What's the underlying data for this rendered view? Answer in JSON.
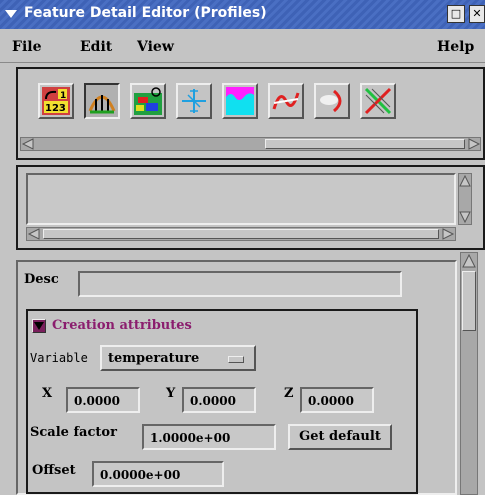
{
  "window": {
    "title": "Feature Detail Editor (Profiles)",
    "minimize_symbol": "□",
    "close_symbol": "✕"
  },
  "menubar": {
    "file": "File",
    "edit": "Edit",
    "view": "View",
    "help": "Help"
  },
  "toolbar": {
    "tools": [
      {
        "icon": "numbered-list-icon"
      },
      {
        "icon": "profile-curve-icon",
        "selected": true
      },
      {
        "icon": "colored-grid-icon"
      },
      {
        "icon": "axes-cross-icon"
      },
      {
        "icon": "cyan-magenta-wave-icon"
      },
      {
        "icon": "red-white-curve-icon"
      },
      {
        "icon": "gray-shape-red-arc-icon"
      },
      {
        "icon": "green-red-crossing-icon"
      }
    ]
  },
  "form": {
    "desc_label": "Desc",
    "desc_value": "",
    "creation": {
      "title": "Creation attributes",
      "variable_label": "Variable",
      "variable_value": "temperature",
      "x_label": "X",
      "x_value": "0.0000",
      "y_label": "Y",
      "y_value": "0.0000",
      "z_label": "Z",
      "z_value": "0.0000",
      "scale_label": "Scale factor",
      "scale_value": "1.0000e+00",
      "get_default_label": "Get default",
      "offset_label": "Offset",
      "offset_value": "0.0000e+00"
    }
  },
  "colors": {
    "title_bg": "#3e62b6",
    "panel_bg": "#c4c4c4",
    "section_title": "#8b1d6e",
    "toggle_bg": "#7a1f5c"
  }
}
